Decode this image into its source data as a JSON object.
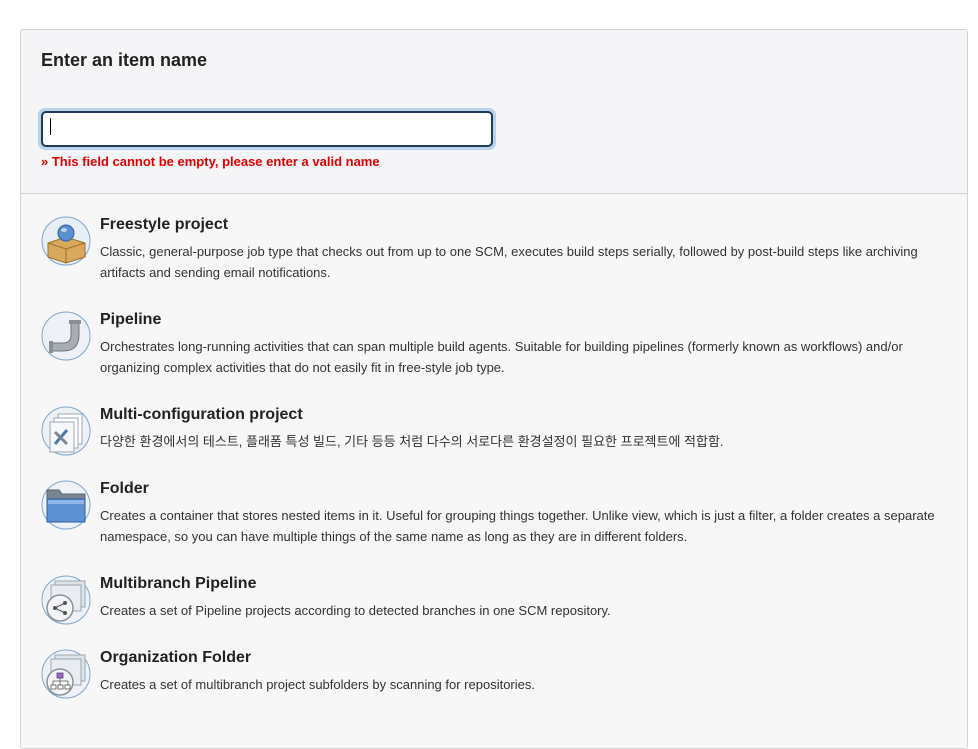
{
  "header": {
    "title": "Enter an item name",
    "input_value": "",
    "error": "» This field cannot be empty, please enter a valid name"
  },
  "items": [
    {
      "name": "Freestyle project",
      "description": "Classic, general-purpose job type that checks out from up to one SCM, executes build steps serially, followed by post-build steps like archiving artifacts and sending email notifications.",
      "icon": "freestyle-project-icon"
    },
    {
      "name": "Pipeline",
      "description": "Orchestrates long-running activities that can span multiple build agents. Suitable for building pipelines (formerly known as workflows) and/or organizing complex activities that do not easily fit in free-style job type.",
      "icon": "pipeline-icon"
    },
    {
      "name": "Multi-configuration project",
      "description": "다양한 환경에서의 테스트, 플래폼 특성 빌드, 기타 등등 처럼 다수의 서로다른 환경설정이 필요한 프로젝트에 적합함.",
      "icon": "multi-configuration-icon"
    },
    {
      "name": "Folder",
      "description": "Creates a container that stores nested items in it. Useful for grouping things together. Unlike view, which is just a filter, a folder creates a separate namespace, so you can have multiple things of the same name as long as they are in different folders.",
      "icon": "folder-icon"
    },
    {
      "name": "Multibranch Pipeline",
      "description": "Creates a set of Pipeline projects according to detected branches in one SCM repository.",
      "icon": "multibranch-pipeline-icon"
    },
    {
      "name": "Organization Folder",
      "description": "Creates a set of multibranch project subfolders by scanning for repositories.",
      "icon": "organization-folder-icon"
    }
  ],
  "colors": {
    "error": "#e10000",
    "input_border": "#1d3c57",
    "input_focus_ring": "#b8d3ea",
    "panel_bg": "#f7f7f8"
  }
}
